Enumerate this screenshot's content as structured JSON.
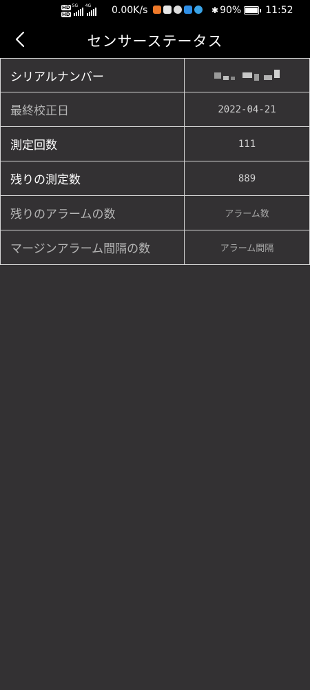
{
  "status_bar": {
    "hd_badges": [
      "HD",
      "HD"
    ],
    "signal_1_label": "5G",
    "signal_2_label": "4G",
    "net_speed": "0.00K/s",
    "battery_percent": "90%",
    "battery_level": 0.9,
    "time": "11:52",
    "app_icons": [
      "video-app-icon",
      "mail-app-icon",
      "assistant-app-icon",
      "search-app-icon",
      "browser-app-icon"
    ],
    "bluetooth_icon": "bluetooth-icon"
  },
  "nav": {
    "title": "センサーステータス",
    "back_icon": "chevron-left-icon"
  },
  "rows": [
    {
      "label": "シリアルナンバー",
      "value": "",
      "value_redacted": true
    },
    {
      "label": "最終校正日",
      "value": "2022-04-21"
    },
    {
      "label": "測定回数",
      "value": "111"
    },
    {
      "label": "残りの測定数",
      "value": "889"
    },
    {
      "label": "残りのアラームの数",
      "value": "アラーム数"
    },
    {
      "label": "マージンアラーム間隔の数",
      "value": "アラーム間隔"
    }
  ],
  "colors": {
    "background": "#333133",
    "header": "#000000",
    "border": "#d8d8d8"
  }
}
